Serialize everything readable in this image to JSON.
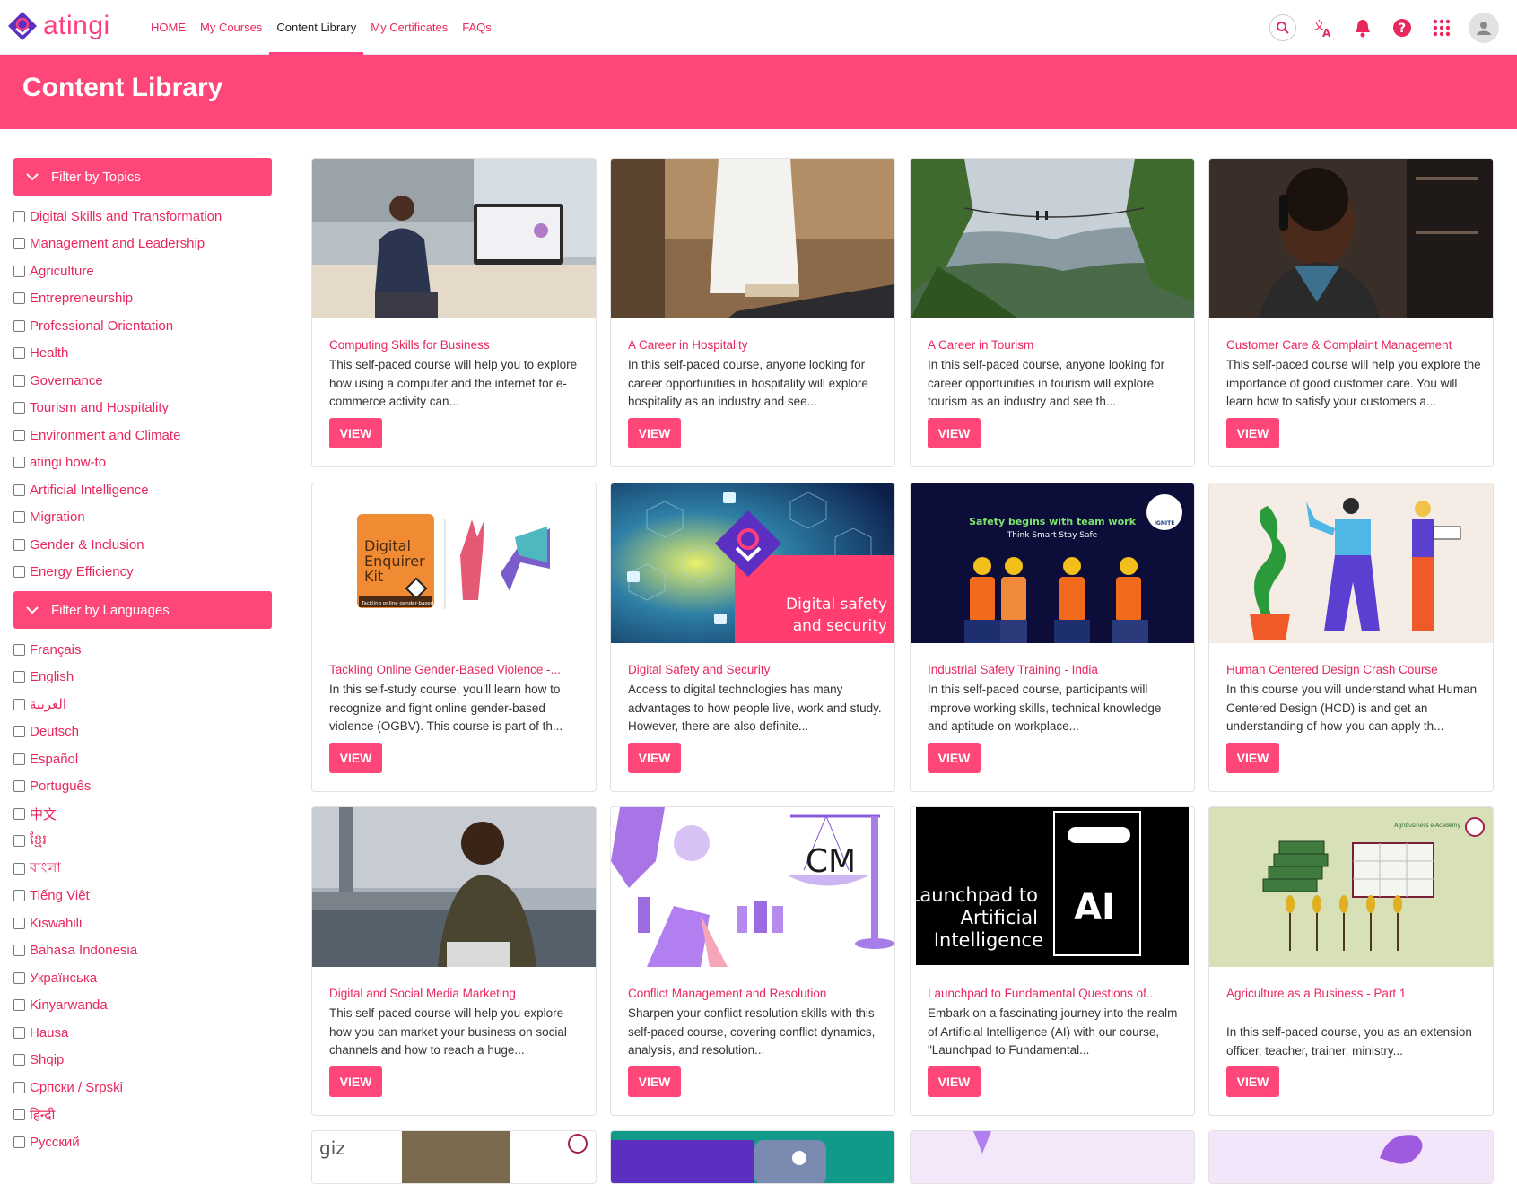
{
  "brand": {
    "name": "atingi",
    "accent": "#ff4679",
    "link": "#e8285d"
  },
  "nav": {
    "items": [
      "HOME",
      "My Courses",
      "Content Library",
      "My Certificates",
      "FAQs"
    ],
    "active": "Content Library"
  },
  "top_icons": [
    "search-icon",
    "translate-icon",
    "bell-icon",
    "help-icon",
    "apps-grid-icon",
    "user-avatar-icon"
  ],
  "page": {
    "title": "Content Library"
  },
  "filters": {
    "topics": {
      "heading": "Filter by Topics",
      "items": [
        "Digital Skills and Transformation",
        "Management and Leadership",
        "Agriculture",
        "Entrepreneurship",
        "Professional Orientation",
        "Health",
        "Governance",
        "Tourism and Hospitality",
        "Environment and Climate",
        "atingi how-to",
        "Artificial Intelligence",
        "Migration",
        "Gender & Inclusion",
        "Energy Efficiency"
      ]
    },
    "languages": {
      "heading": "Filter by Languages",
      "items": [
        "Français",
        "English",
        "العربية",
        "Deutsch",
        "Español",
        "Português",
        "中文",
        "ខ្មែរ",
        "বাংলা",
        "Tiếng Việt",
        "Kiswahili",
        "Bahasa Indonesia",
        "Українська",
        "Kinyarwanda",
        "Hausa",
        "Shqip",
        "Српски / Srpski",
        "हिन्दी",
        "Русский"
      ]
    }
  },
  "courses": [
    {
      "title": "Computing Skills for Business",
      "description": "This self-paced course will help you to explore how using a computer and the internet for e-commerce activity can...",
      "button": "VIEW"
    },
    {
      "title": "A Career in Hospitality",
      "description": "In this self-paced course, anyone looking for career opportunities in hospitality will explore hospitality as an industry and see...",
      "button": "VIEW"
    },
    {
      "title": "A Career in Tourism",
      "description": "In this self-paced course, anyone looking for career opportunities in tourism will explore tourism as an industry and see th...",
      "button": "VIEW"
    },
    {
      "title": "Customer Care & Complaint Management",
      "description": "This self-paced course will help you explore the importance of good customer care. You will learn how to satisfy your customers a...",
      "button": "VIEW"
    },
    {
      "title": "Tackling Online Gender-Based Violence -...",
      "description": "In this self-study course, you’ll learn how to recognize and fight online gender-based violence (OGBV).  This course is part of th...",
      "button": "VIEW",
      "thumb_text": {
        "line1": "Digital",
        "line2": "Enquirer",
        "line3": "Kit",
        "sub": "Tackling online gender-based violence"
      }
    },
    {
      "title": "Digital Safety and Security",
      "description": "Access to digital technologies has many advantages to how people live, work and study. However, there are also definite...",
      "button": "VIEW",
      "thumb_text": {
        "line1": "Digital safety",
        "line2": "and security"
      }
    },
    {
      "title": "Industrial Safety Training - India",
      "description": "In this self-paced course, participants will improve working skills, technical knowledge and aptitude on workplace...",
      "button": "VIEW",
      "thumb_text": {
        "headline": "Safety begins with team work",
        "tagline": "Think Smart Stay Safe",
        "badge": "IGNITE"
      }
    },
    {
      "title": "Human Centered Design Crash Course",
      "description": "In this course you will understand what Human Centered Design (HCD) is and get an understanding of how you can apply th...",
      "button": "VIEW"
    },
    {
      "title": "Digital and Social Media Marketing",
      "description": "This self-paced course will help you explore how you can market your business on social channels and how to reach a huge...",
      "button": "VIEW"
    },
    {
      "title": "Conflict Management and Resolution",
      "description": "Sharpen your conflict resolution skills with this self-paced course, covering conflict dynamics, analysis, and resolution...",
      "button": "VIEW",
      "thumb_text": {
        "label": "CM"
      }
    },
    {
      "title": "Launchpad to Fundamental Questions of...",
      "description": "Embark on a fascinating journey into the realm of Artificial Intelligence (AI) with our course, \"Launchpad to Fundamental...",
      "button": "VIEW",
      "thumb_text": {
        "line1": "Launchpad to",
        "line2": "Artificial",
        "line3": "Intelligence",
        "label": "AI"
      }
    },
    {
      "title": "Agriculture as a Business - Part 1",
      "description": "In this self-paced course, you as an extension officer, teacher, trainer, ministry...",
      "button": "VIEW",
      "thumb_text": {
        "badge": "Agribusiness e-Academy"
      }
    }
  ],
  "partial_cards": {
    "first_thumb_text": "giz"
  }
}
